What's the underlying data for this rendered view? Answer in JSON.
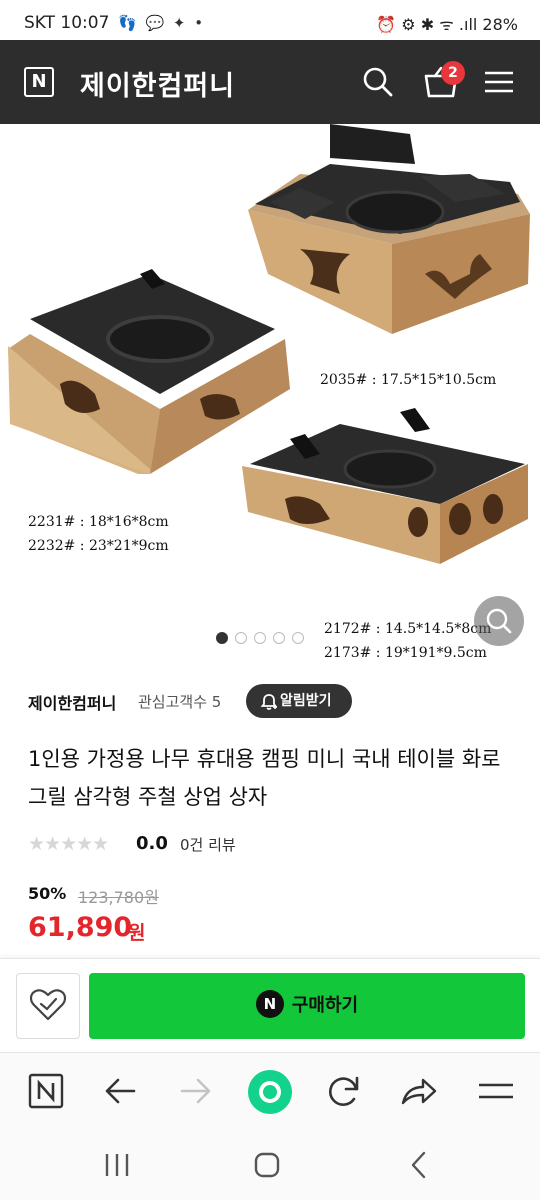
{
  "status_bar": {
    "carrier_time": "SKT 10:07",
    "notification_icons": "👣 💬 ✦ •",
    "system_right": "⏰ ⚙ ✱ ᯤ .ıll 28%"
  },
  "header": {
    "logo_letter": "N",
    "store_name": "제이한컴퍼니",
    "cart_count": "2"
  },
  "product_image": {
    "specs": {
      "spec_2035": "2035# : 17.5*15*10.5cm",
      "spec_2231": "2231# : 18*16*8cm",
      "spec_2232": "2232# : 23*21*9cm",
      "spec_2172": "2172# : 14.5*14.5*8cm",
      "spec_2173": "2173# : 19*191*9.5cm"
    },
    "slide_count": 5,
    "active_slide": 1
  },
  "seller": {
    "name": "제이한컴퍼니",
    "interest": "관심고객수 5",
    "alert_label": "알림받기"
  },
  "product": {
    "title": "1인용 가정용 나무 휴대용 캠핑 미니 국내 테이블 화로 그릴 삼각형 주철 상업 상자",
    "stars": "★★★★★",
    "rating": "0.0",
    "review_count": "0건 리뷰",
    "discount_rate": "50%",
    "original_price": "123,780원",
    "sale_price": "61,890",
    "sale_unit": "원"
  },
  "purchase": {
    "buy_icon": "N",
    "buy_label": "구매하기"
  },
  "colors": {
    "header_bg": "#2d2d2d",
    "buy_green": "#12c739",
    "price_red": "#e3262c",
    "badge_red": "#e8363b"
  },
  "icons": {
    "search": "search-icon",
    "cart": "cart-icon",
    "menu": "menu-icon",
    "zoom": "zoom-icon",
    "wish": "heart-check-icon",
    "bell": "bell-icon"
  }
}
